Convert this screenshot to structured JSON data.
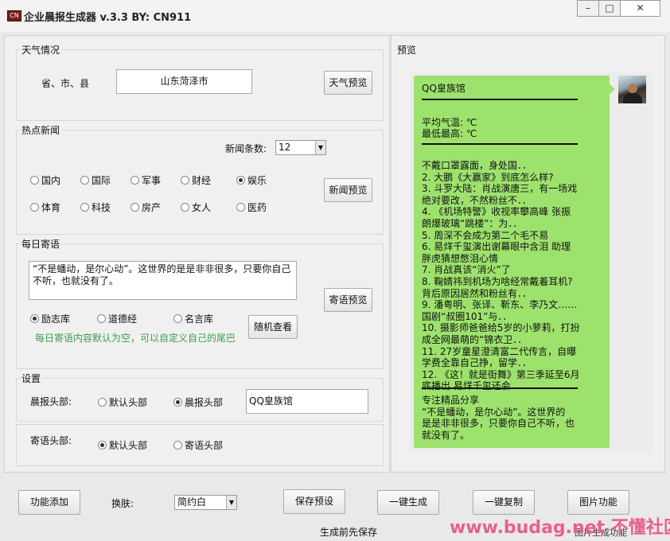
{
  "window": {
    "title": "企业晨报生成器  v.3.3 BY:  CN911",
    "icon_name": "app-icon",
    "minimize_icon": "minimize-icon",
    "maximize_icon": "maximize-icon",
    "close_icon": "close-icon"
  },
  "weather": {
    "group_label": "天气情况",
    "field_label": "省、市、县",
    "location_value": "山东菏泽市",
    "preview_button": "天气预览"
  },
  "news": {
    "group_label": "热点新闻",
    "count_label": "新闻条数:",
    "count_value": "12",
    "categories": [
      {
        "label": "国内",
        "selected": false
      },
      {
        "label": "国际",
        "selected": false
      },
      {
        "label": "军事",
        "selected": false
      },
      {
        "label": "财经",
        "selected": false
      },
      {
        "label": "娱乐",
        "selected": true
      },
      {
        "label": "体育",
        "selected": false
      },
      {
        "label": "科技",
        "selected": false
      },
      {
        "label": "房产",
        "selected": false
      },
      {
        "label": "女人",
        "selected": false
      },
      {
        "label": "医药",
        "selected": false
      }
    ],
    "preview_button": "新闻预览"
  },
  "daily_quote": {
    "group_label": "每日寄语",
    "text": "“不是蟠动，是尔心动”。这世界的是是非非很多，只要你自己不听，也就没有了。",
    "sources": [
      {
        "label": "励志库",
        "selected": true
      },
      {
        "label": "道德经",
        "selected": false
      },
      {
        "label": "名言库",
        "selected": false
      }
    ],
    "random_button": "随机查看",
    "hint": "每日寄语内容默认为空，可以自定义自己的尾巴",
    "preview_button": "寄语预览"
  },
  "settings": {
    "group_label": "设置",
    "header_label": "晨报头部:",
    "header_options": [
      {
        "label": "默认头部",
        "selected": false
      },
      {
        "label": "晨报头部",
        "selected": true
      }
    ],
    "header_value": "QQ皇族馆",
    "quote_header_label": "寄语头部:",
    "quote_header_options": [
      {
        "label": "默认头部",
        "selected": true
      },
      {
        "label": "寄语头部",
        "selected": false
      }
    ]
  },
  "preview": {
    "group_label": "预览",
    "header": "QQ皇族馆",
    "avg_temp": "平均气温:  ℃",
    "temp_range": "最低最高:  ℃",
    "news_lines": [
      "不戴口罩露面，身处国．．",
      "2. 大鹏《大赢家》到底怎么样?",
      "3. 斗罗大陆：肖战演唐三，有一场戏",
      "绝对要改，不然粉丝不．．",
      "4. 《机场特警》收视率攀高峰 张振",
      "朗爆玻璃“跳楼”：为．．",
      "5. 周深不会成为第二个毛不易",
      "6. 易烊千玺演出谢幕眼中含泪 助理",
      "胖虎猜想憋泪心情",
      "7. 肖战真该“消火”了",
      "8. 鞠婧祎到机场为啥经常戴着耳机?",
      "背后原因居然和粉丝有．．",
      "9. 潘粤明、张译、靳东、李乃文……",
      "国剧“叔圈101”与．．",
      "10. 摄影师爸爸给5岁的小萝莉，打扮",
      "成全网最萌的“锦衣卫．．",
      "11. 27岁童星澄清富二代传言，自曝",
      "学费全靠自己挣，留学．．",
      "12. 《这！就是街舞》第三季延至6月",
      "底播出 易烊千玺还会．．"
    ],
    "footer_title": "专注精品分享",
    "footer_lines": [
      " “不是蟠动，是尔心动”。这世界的",
      "是是非非很多，只要你自己不听，也",
      "就没有了。"
    ],
    "avatar_icon": "avatar"
  },
  "toolbar": {
    "add_feature": "功能添加",
    "skin_label": "换肤:",
    "skin_value": "简约白",
    "save_preset": "保存预设",
    "generate": "一键生成",
    "copy": "一键复制",
    "image_feature": "图片功能",
    "save_hint": "生成前先保存",
    "image_generate_hint": "图片生成功能"
  },
  "watermark": {
    "text": "www.budag.net 不懂社区"
  },
  "colors": {
    "bubble_green": "#9de26d",
    "hint_green": "#3aa04a",
    "watermark_pink": "#e8618a",
    "window_bg": "#f0f0f0"
  }
}
